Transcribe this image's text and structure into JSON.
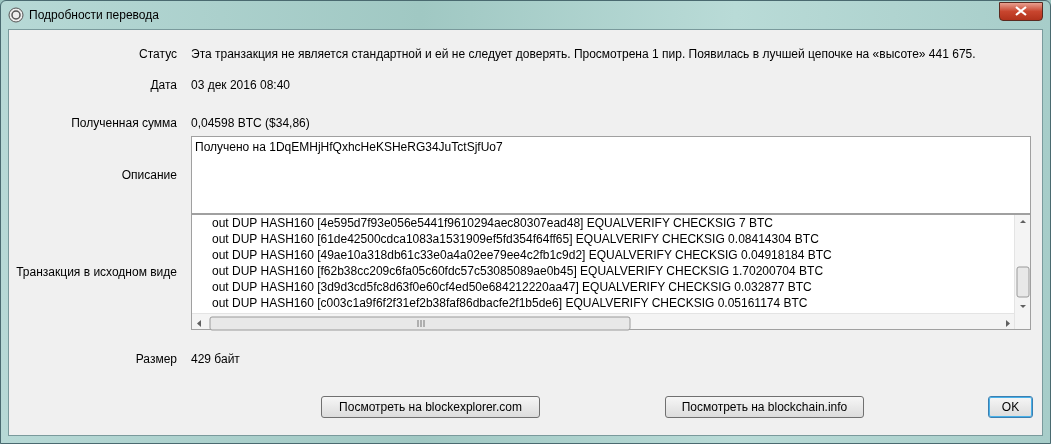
{
  "window": {
    "title": "Подробности перевода"
  },
  "fields": [
    {
      "kind": "text",
      "label": "Статус",
      "value": "Эта транзакция не является стандартной и ей не следует доверять. Просмотрена 1 пир. Появилась в лучшей цепочке на «высоте» 441 675."
    },
    {
      "kind": "text",
      "label": "Дата",
      "value": "03 дек 2016 08:40"
    },
    {
      "kind": "text",
      "label": "Полученная сумма",
      "value": "0,04598 BTC  ($34,86)"
    },
    {
      "kind": "textarea",
      "label": "Описание",
      "value": "Получено на 1DqEMHjHfQxhcHeKSHeRG34JuTctSjfUo7"
    },
    {
      "kind": "raw",
      "label": "Транзакция в исходном виде",
      "lines": [
        "out  DUP HASH160 [4e595d7f93e056e5441f9610294aec80307ead48] EQUALVERIFY CHECKSIG 7 BTC",
        "out  DUP HASH160 [61de42500cdca1083a1531909ef5fd354f64ff65] EQUALVERIFY CHECKSIG 0.08414304 BTC",
        "out  DUP HASH160 [49ae10a318db61c33e0a4a02ee79ee4c2fb1c9d2] EQUALVERIFY CHECKSIG 0.04918184 BTC",
        "out  DUP HASH160 [f62b38cc209c6fa05c60fdc57c53085089ae0b45] EQUALVERIFY CHECKSIG 1.70200704 BTC",
        "out  DUP HASH160 [3d9d3cd5fc8d63f0e60cf4ed50e684212220aa47] EQUALVERIFY CHECKSIG 0.032877 BTC",
        "out  DUP HASH160 [c003c1a9f6f2f31ef2b38faf86dbacfe2f1b5de6] EQUALVERIFY CHECKSIG 0.05161174 BTC"
      ]
    },
    {
      "kind": "text",
      "label": "Размер",
      "value": "429 байт"
    }
  ],
  "buttons": [
    {
      "label": "Посмотреть на blockexplorer.com",
      "default": false
    },
    {
      "label": "Посмотреть на blockchain.info",
      "default": false
    },
    {
      "label": "OK",
      "default": true
    }
  ]
}
